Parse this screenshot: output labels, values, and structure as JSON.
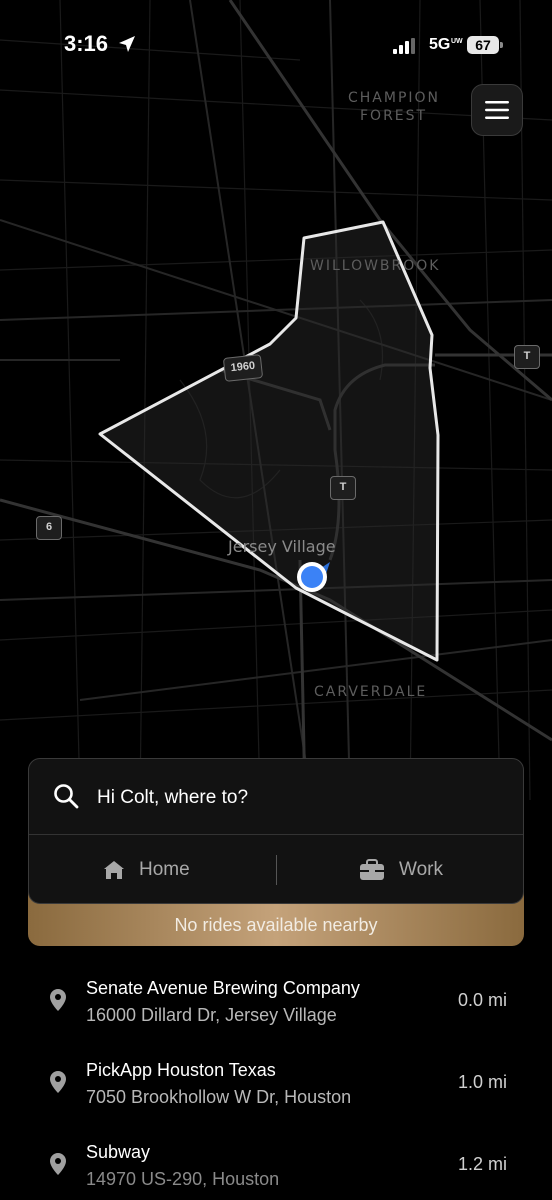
{
  "status_bar": {
    "time": "3:16",
    "network": "5G",
    "network_sub": "UW",
    "battery": "67"
  },
  "map": {
    "labels": {
      "champion": "CHAMPION",
      "forest": "FOREST",
      "willowbrook": "WILLOWBROOK",
      "jersey_village": "Jersey Village",
      "carverdale": "CARVERDALE"
    },
    "shields": {
      "fm1960": "1960",
      "toll_a": "T",
      "toll_b": "T",
      "us6": "6"
    }
  },
  "search": {
    "prompt": "Hi Colt, where to?",
    "home_label": "Home",
    "work_label": "Work"
  },
  "banner": {
    "text": "No rides available nearby"
  },
  "suggestions": [
    {
      "name": "Senate Avenue Brewing Company",
      "address": "16000 Dillard Dr, Jersey Village",
      "distance": "0.0 mi"
    },
    {
      "name": "PickApp Houston Texas",
      "address": "7050 Brookhollow W Dr, Houston",
      "distance": "1.0 mi"
    },
    {
      "name": "Subway",
      "address": "14970 US-290, Houston",
      "distance": "1.2 mi"
    }
  ],
  "colors": {
    "background": "#000000",
    "card": "#121212",
    "banner_gold": "#b8966a",
    "location_blue": "#3b82f6"
  }
}
